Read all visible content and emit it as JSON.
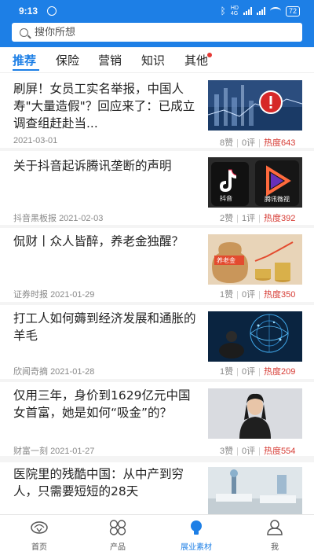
{
  "status": {
    "time": "9:13",
    "battery": "72"
  },
  "search": {
    "placeholder": "搜你所想"
  },
  "tabs": [
    {
      "label": "推荐",
      "active": true
    },
    {
      "label": "保险"
    },
    {
      "label": "营销"
    },
    {
      "label": "知识"
    },
    {
      "label": "其他",
      "has_dot": true
    }
  ],
  "articles": [
    {
      "title": "刷屏！女员工实名举报，中国人寿\"大量造假\"？回应来了：已成立调查组赶赴当...",
      "source": "",
      "date": "2021-03-01",
      "likes": "8赞",
      "comments": "0评",
      "heat": "热度643"
    },
    {
      "title": "关于抖音起诉腾讯垄断的声明",
      "source": "抖音黑板报",
      "date": "2021-02-03",
      "likes": "2赞",
      "comments": "1评",
      "heat": "热度392"
    },
    {
      "title": "侃财丨众人皆醉，养老金独醒？",
      "source": "证券时报",
      "date": "2021-01-29",
      "likes": "1赞",
      "comments": "0评",
      "heat": "热度350"
    },
    {
      "title": "打工人如何薅到经济发展和通胀的羊毛",
      "source": "欣闻奇摘",
      "date": "2021-01-28",
      "likes": "1赞",
      "comments": "0评",
      "heat": "热度209"
    },
    {
      "title": "仅用三年，身价到1629亿元中国女首富，她是如何“吸金”的？",
      "source": "财富一刻",
      "date": "2021-01-27",
      "likes": "3赞",
      "comments": "0评",
      "heat": "热度554"
    },
    {
      "title": "医院里的残酷中国：从中产到穷人，只需要短短的28天",
      "source": "",
      "date": "",
      "likes": "",
      "comments": "",
      "heat": ""
    }
  ],
  "thumb_text": {
    "tiktok_label": "抖音",
    "tencent_label": "腾讯微视",
    "pension_label": "养老金"
  },
  "bottom_nav": [
    {
      "label": "首页"
    },
    {
      "label": "产品"
    },
    {
      "label": "展业素材",
      "active": true
    },
    {
      "label": "我"
    }
  ],
  "colors": {
    "brand": "#1d7fe6",
    "heat": "#d63a33",
    "dot": "#e53935"
  }
}
